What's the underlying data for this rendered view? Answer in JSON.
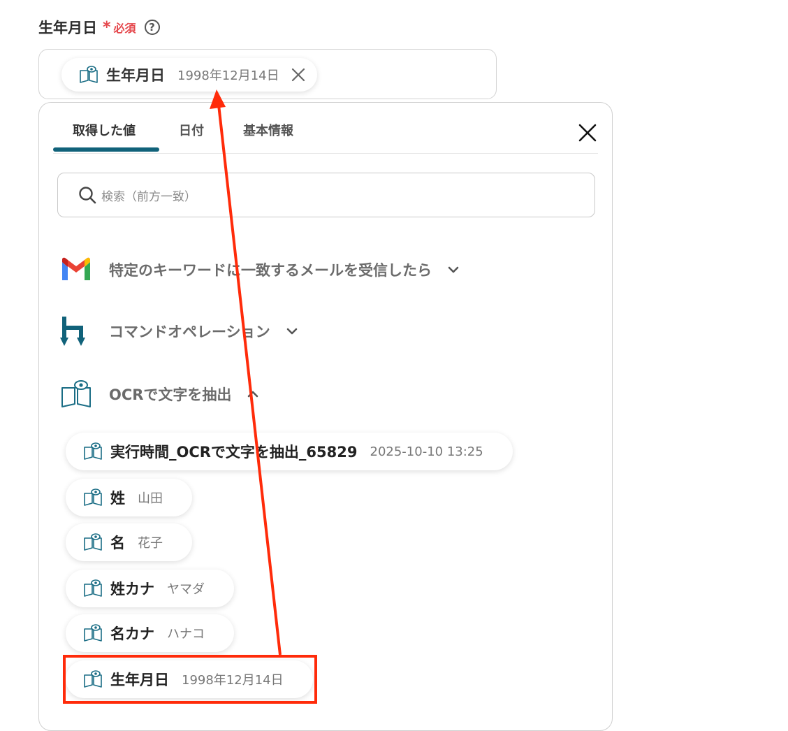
{
  "field": {
    "label": "生年月日",
    "required_mark": "*",
    "required_text": "必須",
    "help_icon": "?"
  },
  "selected_chip": {
    "icon": "ocr-book-icon",
    "name": "生年月日",
    "value": "1998年12月14日"
  },
  "panel": {
    "tabs": [
      {
        "label": "取得した値",
        "active": true
      },
      {
        "label": "日付",
        "active": false
      },
      {
        "label": "基本情報",
        "active": false
      }
    ],
    "search_placeholder": "検索（前方一致）",
    "groups": [
      {
        "icon": "gmail-icon",
        "title": "特定のキーワードに一致するメールを受信したら",
        "expanded": false
      },
      {
        "icon": "command-operation-icon",
        "title": "コマンドオペレーション",
        "expanded": false
      },
      {
        "icon": "ocr-book-icon",
        "title": "OCRで文字を抽出",
        "expanded": true
      }
    ],
    "items": [
      {
        "name": "実行時間_OCRで文字を抽出_65829",
        "value": "2025-10-10 13:25"
      },
      {
        "name": "姓",
        "value": "山田"
      },
      {
        "name": "名",
        "value": "花子"
      },
      {
        "name": "姓カナ",
        "value": "ヤマダ"
      },
      {
        "name": "名カナ",
        "value": "ハナコ"
      },
      {
        "name": "生年月日",
        "value": "1998年12月14日"
      }
    ]
  },
  "colors": {
    "accent": "#11627a",
    "required": "#e5484d",
    "annotation": "#ff2b0a"
  }
}
